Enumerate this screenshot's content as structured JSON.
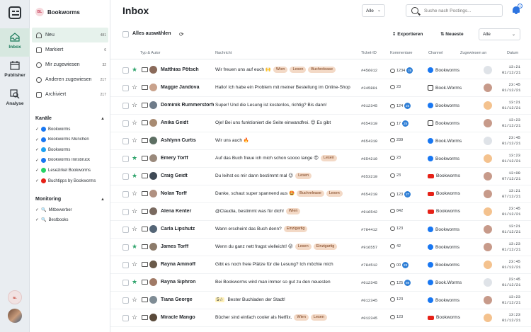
{
  "rail": {
    "items": [
      {
        "label": "Inbox",
        "active": true
      },
      {
        "label": "Publisher",
        "active": false
      },
      {
        "label": "Analyse",
        "active": false
      }
    ]
  },
  "sidebar": {
    "brand": "Bookworms",
    "brand_badge": "BL",
    "nav": [
      {
        "label": "Neu",
        "count": "481"
      },
      {
        "label": "Markiert",
        "count": "6"
      },
      {
        "label": "Mir zugewiesen",
        "count": "32"
      },
      {
        "label": "Anderen zugewiesen",
        "count": "217"
      },
      {
        "label": "Archiviert",
        "count": "217"
      }
    ],
    "channels_title": "Kanäle",
    "channels": [
      {
        "label": "Bookworms",
        "network": "facebook"
      },
      {
        "label": "Bookworms München",
        "network": "facebook"
      },
      {
        "label": "Bookworms",
        "network": "twitter"
      },
      {
        "label": "Bookworms Innsbruck",
        "network": "facebook"
      },
      {
        "label": "Lesezirkel Bookworms",
        "network": "whatsapp"
      },
      {
        "label": "Buchtipps by Bookworms",
        "network": "youtube"
      }
    ],
    "monitoring_title": "Monitoring",
    "monitoring": [
      {
        "label": "Mitbewerber"
      },
      {
        "label": "Bestbooks"
      }
    ]
  },
  "header": {
    "title": "Inbox",
    "filter": "Alle",
    "search_placeholder": "Suche nach Postings...",
    "notifications": "3"
  },
  "toolbar": {
    "select_all": "Alles auswählen",
    "export": "Exportieren",
    "sort": "Neueste",
    "filter": "Alle"
  },
  "columns": [
    "Typ & Autor",
    "Nachricht",
    "Ticket-ID",
    "Kommentare",
    "Channel",
    "Zugewiesen an",
    "Datum"
  ],
  "rows": [
    {
      "starred": true,
      "author": "Matthias Pötsch",
      "message": "Wir freuen uns auf euch 🙌",
      "tags": [
        "Wien",
        "Lesen",
        "Buchrelease"
      ],
      "ticket": "#456012",
      "comments": "1234",
      "badge": "25",
      "channel": "Bookworms",
      "network": "facebook",
      "date": "13:21",
      "date2": "01/12/21"
    },
    {
      "starred": false,
      "author": "Maggie Jandova",
      "message": "Hallo! Ich habe ein Problem mit meiner Bestellung im Online-Shop",
      "tags": [],
      "ticket": "#345801",
      "comments": "23",
      "badge": "",
      "channel": "Book.Worms",
      "network": "instagram",
      "date": "23:45",
      "date2": "01/12/21"
    },
    {
      "starred": false,
      "author": "Dominik Rummerstorfer",
      "message": "Super! Und die Lesung ist kostenlos, richtig? Bis dann!",
      "tags": [],
      "ticket": "#012345",
      "comments": "124",
      "badge": "25",
      "channel": "Bookworms",
      "network": "facebook",
      "date": "13:21",
      "date2": "01/12/21"
    },
    {
      "starred": false,
      "author": "Anika Geidt",
      "message": "Oje! Bei uns funktioniert die Seite einwandfrei. 😊 Es gibt",
      "tags": [],
      "ticket": "#654310",
      "comments": "17",
      "badge": "25",
      "channel": "Bookworms",
      "network": "instagram",
      "date": "13:23",
      "date2": "01/12/21"
    },
    {
      "starred": false,
      "author": "Ashlynn Curtis",
      "message": "Wir uns auch 🔥",
      "tags": [],
      "ticket": "#654310",
      "comments": "239",
      "badge": "",
      "channel": "Book.Worms",
      "network": "facebook",
      "date": "23:45",
      "date2": "01/12/21"
    },
    {
      "starred": true,
      "author": "Emery Torff",
      "message": "Auf das Buch freue ich mich schon soooo lange 😍",
      "tags": [
        "Lesen"
      ],
      "ticket": "#654210",
      "comments": "23",
      "badge": "",
      "channel": "Bookworms",
      "network": "facebook",
      "date": "13:23",
      "date2": "01/12/21"
    },
    {
      "starred": true,
      "author": "Craig Geidt",
      "message": "Du leihst es mir dann bestimmt mal 😉",
      "tags": [
        "Lesen"
      ],
      "ticket": "#653210",
      "comments": "23",
      "badge": "",
      "channel": "Bookworms",
      "network": "youtube",
      "date": "13:09",
      "date2": "07/12/21"
    },
    {
      "starred": false,
      "author": "Nolan Torff",
      "message": "Danke, schaut super spannend aus 🤩",
      "tags": [
        "Buchrelease",
        "Lesen"
      ],
      "ticket": "#654210",
      "comments": "123",
      "badge": "27",
      "channel": "Bookworms",
      "network": "youtube",
      "date": "13:21",
      "date2": "07/12/21"
    },
    {
      "starred": false,
      "author": "Alena Kenter",
      "message": "@Claudia, bestimmt was für dich!",
      "tags": [
        "Wien"
      ],
      "ticket": "#916542",
      "comments": "842",
      "badge": "",
      "channel": "Bookworms",
      "network": "youtube",
      "date": "23:45",
      "date2": "01/12/21"
    },
    {
      "starred": false,
      "author": "Carla Lipshutz",
      "message": "Wann erscheint das Buch denn?",
      "tags": [
        "Einzigartig"
      ],
      "ticket": "#784412",
      "comments": "123",
      "badge": "",
      "channel": "Bookworms",
      "network": "facebook",
      "date": "13:21",
      "date2": "01/12/21"
    },
    {
      "starred": true,
      "author": "James Torff",
      "message": "Wenn du ganz nett fragst vielleicht! 😜",
      "tags": [
        "Lesen",
        "Einzigartig"
      ],
      "ticket": "#916557",
      "comments": "42",
      "badge": "",
      "channel": "Bookworms",
      "network": "facebook",
      "date": "13:23",
      "date2": "01/12/21"
    },
    {
      "starred": false,
      "author": "Rayna Aminoff",
      "message": "Gibt es noch freie Plätze für die Lesung? Ich möchte mich",
      "tags": [],
      "ticket": "#784512",
      "comments": "00",
      "badge": "23",
      "channel": "Bookworms",
      "network": "facebook",
      "date": "23:45",
      "date2": "01/12/21"
    },
    {
      "starred": true,
      "author": "Rayna Siphron",
      "message": "Bei Bookworms wird man immer so gut zu den neuesten",
      "tags": [],
      "ticket": "#012345",
      "comments": "125",
      "badge": "89",
      "channel": "Book.Worms",
      "network": "facebook",
      "date": "23:45",
      "date2": "01/12/21"
    },
    {
      "starred": false,
      "author": "Tiana George",
      "message": "Bester Buchladen der Stadt!",
      "tags": [],
      "rating": "5☆",
      "ticket": "#012345",
      "comments": "123",
      "badge": "",
      "channel": "Bookworms",
      "network": "facebook",
      "date": "13:23",
      "date2": "01/12/21"
    },
    {
      "starred": false,
      "author": "Miracle Mango",
      "message": "Bücher sind einfach cooler als Netflix.",
      "tags": [
        "Wien",
        "Lesen"
      ],
      "ticket": "#012345",
      "comments": "123",
      "badge": "",
      "channel": "Bookworms",
      "network": "youtube",
      "date": "13:23",
      "date2": "01/12/21"
    }
  ],
  "colors": {
    "accent_green": "#2ea36b",
    "facebook": "#1877f2",
    "youtube": "#e62117",
    "tag_bg": "#f3d9c6",
    "badge_blue": "#2f7fd6"
  }
}
